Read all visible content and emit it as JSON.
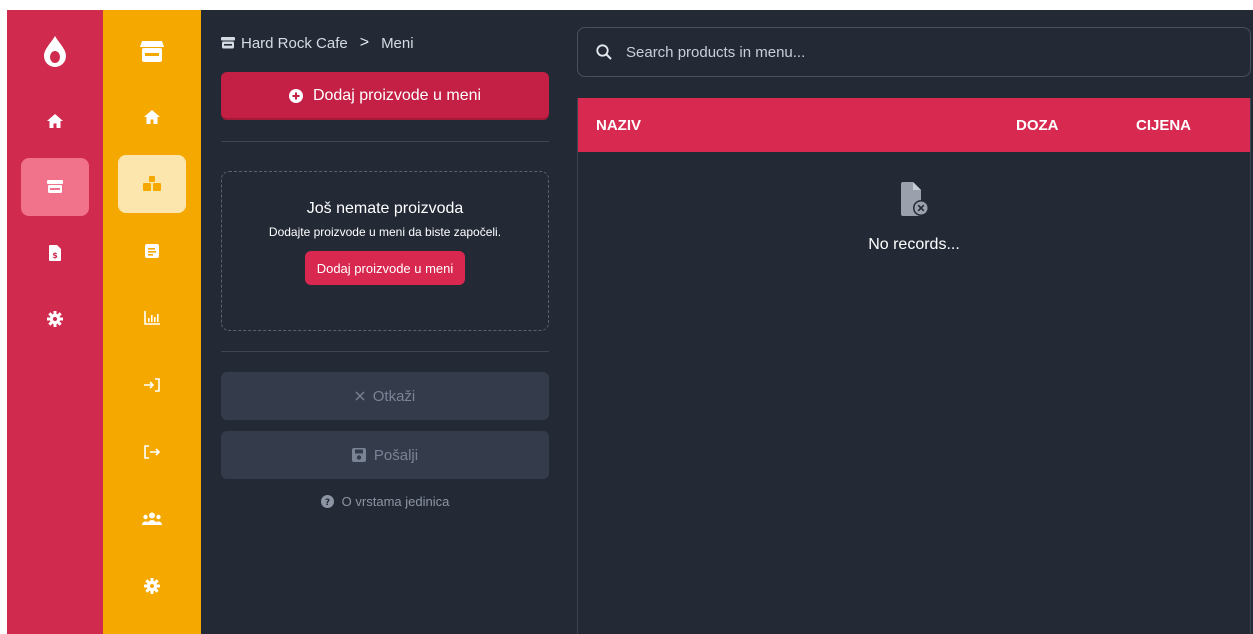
{
  "colors": {
    "rail_primary": "#d02a4e",
    "rail_secondary": "#f5a800",
    "background": "#232a36",
    "accent": "#c41f44",
    "table_header": "#d82a51"
  },
  "rail_primary": {
    "logo_icon": "drop-icon",
    "items": [
      {
        "icon": "home-icon",
        "active": false
      },
      {
        "icon": "store-icon",
        "active": true
      },
      {
        "icon": "invoice-icon",
        "active": false
      },
      {
        "icon": "gear-icon",
        "active": false
      }
    ]
  },
  "rail_secondary": {
    "top_icon": "store-icon",
    "items": [
      {
        "icon": "home-icon",
        "active": false
      },
      {
        "icon": "boxes-icon",
        "active": true
      },
      {
        "icon": "document-icon",
        "active": false
      },
      {
        "icon": "chart-icon",
        "active": false
      },
      {
        "icon": "login-icon",
        "active": false
      },
      {
        "icon": "logout-icon",
        "active": false
      },
      {
        "icon": "users-icon",
        "active": false
      },
      {
        "icon": "gear-icon",
        "active": false
      }
    ]
  },
  "breadcrumb": {
    "store": "Hard Rock Cafe",
    "separator": ">",
    "page": "Meni"
  },
  "actions": {
    "add_label": "Dodaj proizvode u meni",
    "cancel_label": "Otkaži",
    "send_label": "Pošalji",
    "help_label": "O vrstama jedinica"
  },
  "empty_state": {
    "title": "Još nemate proizvoda",
    "subtitle": "Dodajte proizvode u meni da biste započeli.",
    "button_label": "Dodaj proizvode u meni"
  },
  "search": {
    "placeholder": "Search products in menu...",
    "value": ""
  },
  "table": {
    "columns": [
      "NAZIV",
      "DOZA",
      "CIJENA"
    ],
    "rows": [],
    "empty_text": "No records..."
  }
}
